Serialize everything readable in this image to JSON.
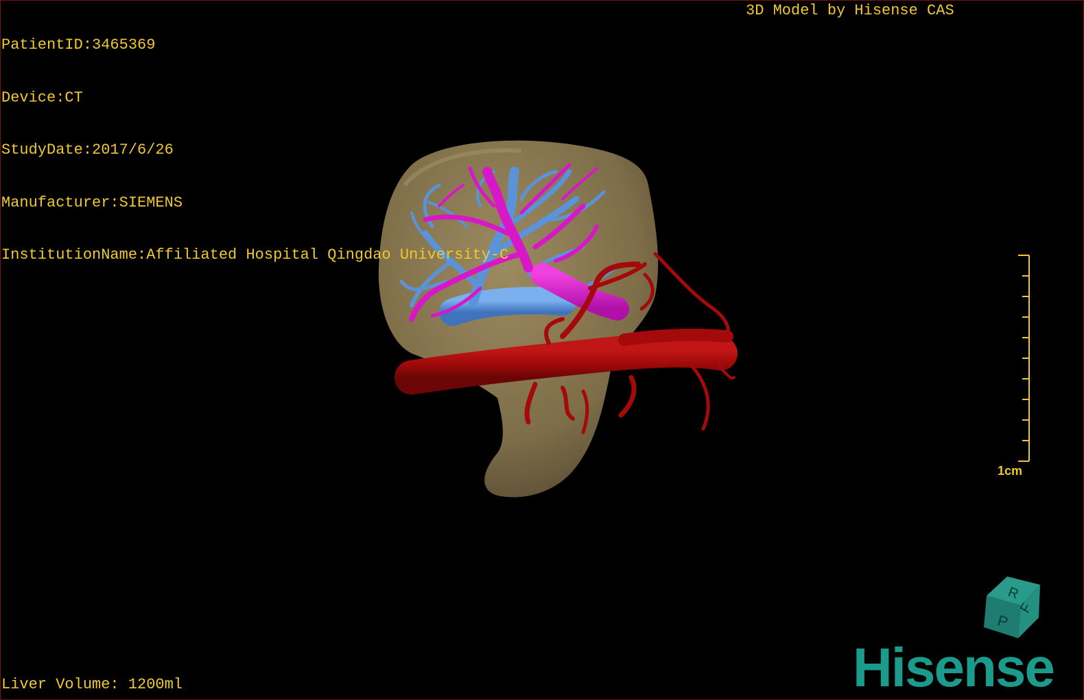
{
  "overlay": {
    "patient_id": "PatientID:3465369",
    "device": "Device:CT",
    "study_date": "StudyDate:2017/6/26",
    "manufacturer": "Manufacturer:SIEMENS",
    "institution": "InstitutionName:Affiliated Hospital Qingdao University-C",
    "model_credit": "3D Model by Hisense CAS",
    "liver_volume": "Liver Volume: 1200ml"
  },
  "scale_bar": {
    "label": "1cm",
    "ticks": 10
  },
  "orientation_cube": {
    "faces": [
      "R",
      "F",
      "P"
    ]
  },
  "logo": {
    "text": "Hisense"
  },
  "colors": {
    "overlay_text": "#f0c830",
    "liver": "#8b7a52",
    "portal_vein": "#5b93d8",
    "hepatic_vein": "#d818c8",
    "artery": "#a50a0a",
    "brand": "#1a9b8c"
  }
}
